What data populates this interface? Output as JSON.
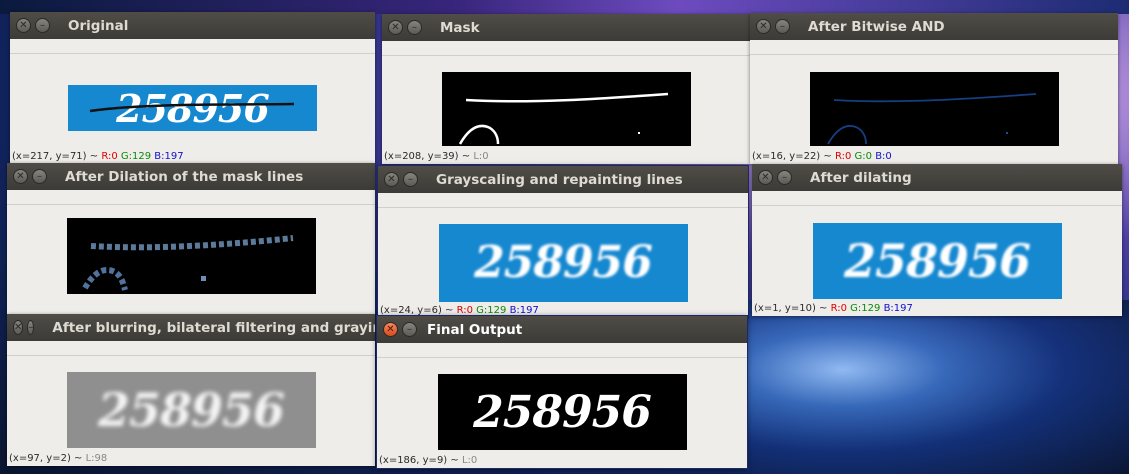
{
  "windows": {
    "original": {
      "title": "Original",
      "status": {
        "coords": "(x=217, y=71) ~",
        "r": "R:0",
        "g": "G:129",
        "b": "B:197"
      },
      "captcha": "258956"
    },
    "mask": {
      "title": "Mask",
      "status": {
        "coords": "(x=208, y=39) ~",
        "l": "L:0"
      }
    },
    "bitwise": {
      "title": "After Bitwise AND",
      "status": {
        "coords": "(x=16, y=22) ~",
        "r": "R:0",
        "g": "G:0",
        "b": "B:0"
      }
    },
    "dilation_mask": {
      "title": "After Dilation of the mask lines"
    },
    "grayscaling": {
      "title": "Grayscaling and repainting lines",
      "status": {
        "coords": "(x=24, y=6) ~",
        "r": "R:0",
        "g": "G:129",
        "b": "B:197"
      },
      "captcha": "258956"
    },
    "dilating": {
      "title": "After dilating",
      "status": {
        "coords": "(x=1, y=10) ~",
        "r": "R:0",
        "g": "G:129",
        "b": "B:197"
      },
      "captcha": "258956"
    },
    "blurring": {
      "title": "After blurring, bilateral filtering and graying",
      "status": {
        "coords": "(x=97, y=2) ~",
        "l": "L:98"
      },
      "captcha": "258956"
    },
    "final": {
      "title": "Final Output",
      "status": {
        "coords": "(x=186, y=9) ~",
        "l": "L:0"
      },
      "captcha": "258956"
    }
  },
  "colors": {
    "titlebar": "#3c3b37",
    "window_bg": "#efedea",
    "captcha_blue": "#1688d0",
    "close_active": "#e05a2b"
  },
  "icons": {
    "close": "close-icon",
    "minimize": "minimize-icon"
  }
}
